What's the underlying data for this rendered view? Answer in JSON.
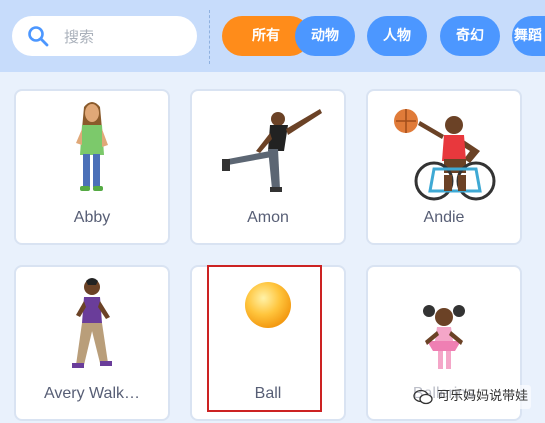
{
  "search": {
    "placeholder": "搜索"
  },
  "categories": [
    {
      "label": "所有",
      "active": true
    },
    {
      "label": "动物",
      "active": false
    },
    {
      "label": "人物",
      "active": false
    },
    {
      "label": "奇幻",
      "active": false
    },
    {
      "label": "舞蹈",
      "active": false
    }
  ],
  "sprites": [
    {
      "name": "Abby"
    },
    {
      "name": "Amon"
    },
    {
      "name": "Andie"
    },
    {
      "name": "Avery Walk…"
    },
    {
      "name": "Ball"
    },
    {
      "name": "Ballerina"
    }
  ],
  "watermark": {
    "text": "可乐妈妈说带娃"
  },
  "colors": {
    "accent": "#4c97ff",
    "active": "#ff8c1a",
    "highlight": "#cc2222"
  }
}
